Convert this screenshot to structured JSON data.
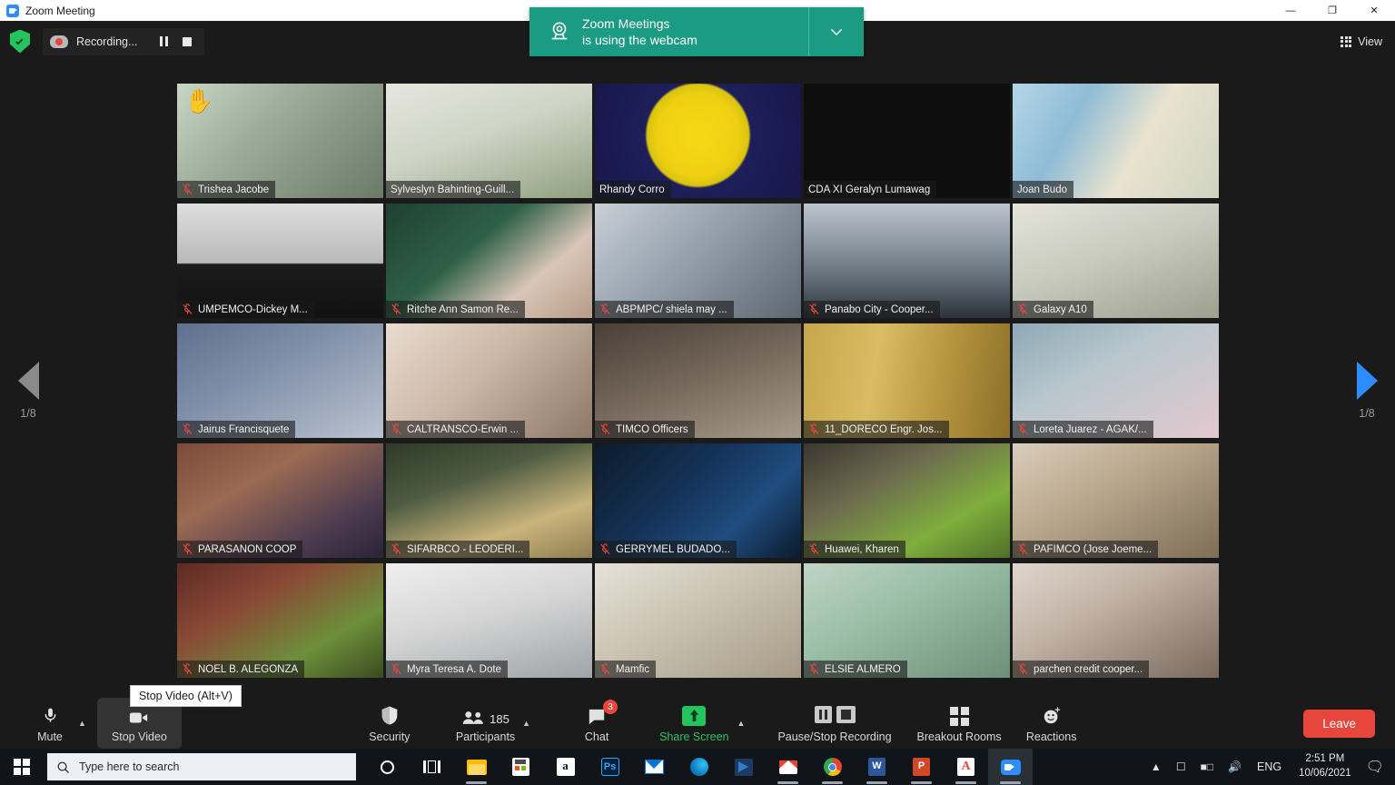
{
  "window": {
    "title": "Zoom Meeting",
    "icon": "zoom-app-icon",
    "minimize": "—",
    "maximize": "❐",
    "close": "✕"
  },
  "topbar": {
    "encryption_icon": "shield-check-icon",
    "recording_label": "Recording...",
    "recording_icon": "cloud-record-icon",
    "pause_icon": "pause-icon",
    "stop_icon": "stop-icon",
    "view_label": "View",
    "view_icon": "grid-view-icon"
  },
  "toast": {
    "icon": "webcam-icon",
    "line1": "Zoom Meetings",
    "line2": "is using the webcam",
    "chevron": "chevron-down-icon",
    "color": "#1b9b82"
  },
  "gallery": {
    "prev_page_label": "1/8",
    "next_page_label": "1/8",
    "active_tile_color": "#e8e24a",
    "participants": [
      {
        "name": "Trishea Jacobe",
        "muted": true,
        "hand": "✋",
        "active": false,
        "bg": "linear-gradient(135deg,#c8d6c4 0%,#9fae9b 38%,#6b7a66 100%)"
      },
      {
        "name": "Sylveslyn Bahinting-Guill...",
        "muted": false,
        "active": true,
        "bg": "linear-gradient(160deg,#e6e6df 0%,#cfd4c6 45%,#8fa07f 100%)"
      },
      {
        "name": "Rhandy Corro",
        "muted": false,
        "active": false,
        "bg": "radial-gradient(circle at 50% 45%,#f5d916 0%,#f0cf12 34%,#d8c40f 42%,#1e1e5a 44%,#17174a 100%)"
      },
      {
        "name": "CDA XI Geralyn Lumawag",
        "muted": false,
        "active": false,
        "bg": "#0e0e0e"
      },
      {
        "name": "Joan Budo",
        "muted": false,
        "active": false,
        "bg": "linear-gradient(120deg,#b5d6e8 0%,#8fbcd6 30%,#e9e3cf 60%,#cfd3c2 100%)"
      },
      {
        "name": "UMPEMCO-Dickey M...",
        "muted": true,
        "active": false,
        "bg": "linear-gradient(180deg,#dedede 0%,#b9b9b9 52%,#1c1c1c 53%,#111 100%)"
      },
      {
        "name": "Ritche Ann Samon Re...",
        "muted": true,
        "active": false,
        "bg": "linear-gradient(140deg,#1f4032 0%,#2f6047 40%,#d9c6b8 70%,#b89c88 100%)"
      },
      {
        "name": "ABPMPC/ shiela may ...",
        "muted": true,
        "active": false,
        "bg": "linear-gradient(135deg,#c9cfd6 0%,#9aa6b2 40%,#5d6773 100%)"
      },
      {
        "name": "Panabo City - Cooper...",
        "muted": true,
        "active": false,
        "bg": "linear-gradient(180deg,#bcc4cc 0%,#8d98a3 35%,#5c6670 70%,#2b3239 100%)"
      },
      {
        "name": "Galaxy A10",
        "muted": true,
        "active": false,
        "bg": "linear-gradient(160deg,#e4e4dc 0%,#c9cbbe 45%,#9da08f 100%)"
      },
      {
        "name": "Jairus Francisquete",
        "muted": true,
        "active": false,
        "bg": "linear-gradient(150deg,#5f6f8e 0%,#7f8ea8 40%,#b9c2cf 100%)"
      },
      {
        "name": "CALTRANSCO-Erwin ...",
        "muted": true,
        "active": false,
        "bg": "linear-gradient(135deg,#e9dcd0 0%,#cbb7a6 45%,#8d7868 100%)"
      },
      {
        "name": "TIMCO Officers",
        "muted": true,
        "active": false,
        "bg": "linear-gradient(160deg,#4a4038 0%,#6d6054 40%,#a89a89 100%)"
      },
      {
        "name": "11_DORECO Engr. Jos...",
        "muted": true,
        "active": false,
        "bg": "linear-gradient(100deg,#c6a64c 0%,#d9bc63 35%,#b2913c 70%,#8a6f2a 100%)"
      },
      {
        "name": "Loreta Juarez - AGAK/...",
        "muted": true,
        "active": false,
        "bg": "linear-gradient(150deg,#8ea9b5 0%,#b8c7cd 40%,#e2c8cf 100%)"
      },
      {
        "name": "PARASANON COOP",
        "muted": true,
        "active": false,
        "bg": "linear-gradient(150deg,#7a4b3a 0%,#9b6a52 35%,#4a3a50 75%,#2a2436 100%)"
      },
      {
        "name": "SIFARBCO - LEODERI...",
        "muted": true,
        "active": false,
        "bg": "linear-gradient(160deg,#2e3a28 0%,#4f5c42 35%,#c9b47c 70%,#8f7e52 100%)"
      },
      {
        "name": "GERRYMEL BUDADO...",
        "muted": true,
        "active": false,
        "bg": "linear-gradient(135deg,#0d1a2b 0%,#143255 40%,#1f4d80 70%,#0b1a2a 100%)"
      },
      {
        "name": "Huawei, Kharen",
        "muted": true,
        "active": false,
        "bg": "linear-gradient(150deg,#3a3730 0%,#6d6a4f 35%,#7fae3d 70%,#4e6f28 100%)"
      },
      {
        "name": "PAFIMCO (Jose Joeme...",
        "muted": true,
        "active": false,
        "bg": "linear-gradient(150deg,#d9cdbb 0%,#bba98f 40%,#7e6e58 100%)"
      },
      {
        "name": "NOEL B. ALEGONZA",
        "muted": true,
        "active": false,
        "bg": "linear-gradient(150deg,#5e2a24 0%,#8a4a36 35%,#6d8f3a 70%,#3a4a20 100%)"
      },
      {
        "name": "Myra Teresa A. Dote",
        "muted": true,
        "active": false,
        "bg": "linear-gradient(165deg,#efefef 0%,#d6d6d6 45%,#9fa4a8 100%)"
      },
      {
        "name": "Mamfic",
        "muted": true,
        "active": false,
        "bg": "linear-gradient(150deg,#e6e2d8 0%,#cdc6b6 40%,#a59b87 100%)"
      },
      {
        "name": "ELSIE ALMERO",
        "muted": true,
        "active": false,
        "bg": "linear-gradient(150deg,#bfd4c5 0%,#9cbfa8 40%,#6e9079 100%)"
      },
      {
        "name": "parchen credit cooper...",
        "muted": true,
        "active": false,
        "bg": "linear-gradient(150deg,#e0d6cd 0%,#c1b2a5 40%,#7a6a5e 100%)"
      }
    ]
  },
  "controls": {
    "mute": {
      "label": "Mute",
      "icon": "microphone-icon",
      "caret": "chevron-up-icon"
    },
    "video": {
      "label": "Stop Video",
      "icon": "camera-icon",
      "tooltip": "Stop Video (Alt+V)"
    },
    "security": {
      "label": "Security",
      "icon": "shield-icon"
    },
    "participants": {
      "label": "Participants",
      "icon": "people-icon",
      "count": "185",
      "caret": "chevron-up-icon"
    },
    "chat": {
      "label": "Chat",
      "icon": "chat-bubble-icon",
      "badge": "3"
    },
    "share": {
      "label": "Share Screen",
      "icon": "share-arrow-icon",
      "caret": "chevron-up-icon",
      "color": "#23c55e"
    },
    "recording": {
      "label": "Pause/Stop Recording",
      "pause_icon": "pause-icon",
      "stop_icon": "stop-icon"
    },
    "breakout": {
      "label": "Breakout Rooms",
      "icon": "breakout-grid-icon"
    },
    "reactions": {
      "label": "Reactions",
      "icon": "smiley-plus-icon"
    },
    "leave": {
      "label": "Leave",
      "color": "#e8453c"
    }
  },
  "taskbar": {
    "start_icon": "windows-start-icon",
    "search_placeholder": "Type here to search",
    "search_icon": "search-icon",
    "apps": [
      {
        "name": "cortana-icon"
      },
      {
        "name": "task-view-icon"
      },
      {
        "name": "file-explorer-icon"
      },
      {
        "name": "microsoft-store-icon"
      },
      {
        "name": "amazon-icon"
      },
      {
        "name": "photoshop-icon"
      },
      {
        "name": "mail-icon"
      },
      {
        "name": "microsoft-edge-icon"
      },
      {
        "name": "vs-code-icon"
      },
      {
        "name": "gmail-icon"
      },
      {
        "name": "google-chrome-icon"
      },
      {
        "name": "microsoft-word-icon"
      },
      {
        "name": "powerpoint-icon"
      },
      {
        "name": "adobe-reader-icon"
      },
      {
        "name": "zoom-icon"
      }
    ],
    "tray": {
      "expand_icon": "chevron-up-icon",
      "camera_icon": "camera-privacy-icon",
      "battery_icon": "battery-icon",
      "volume_icon": "volume-icon",
      "language": "ENG",
      "time": "2:51 PM",
      "date": "10/06/2021",
      "notification_icon": "action-center-icon"
    }
  }
}
